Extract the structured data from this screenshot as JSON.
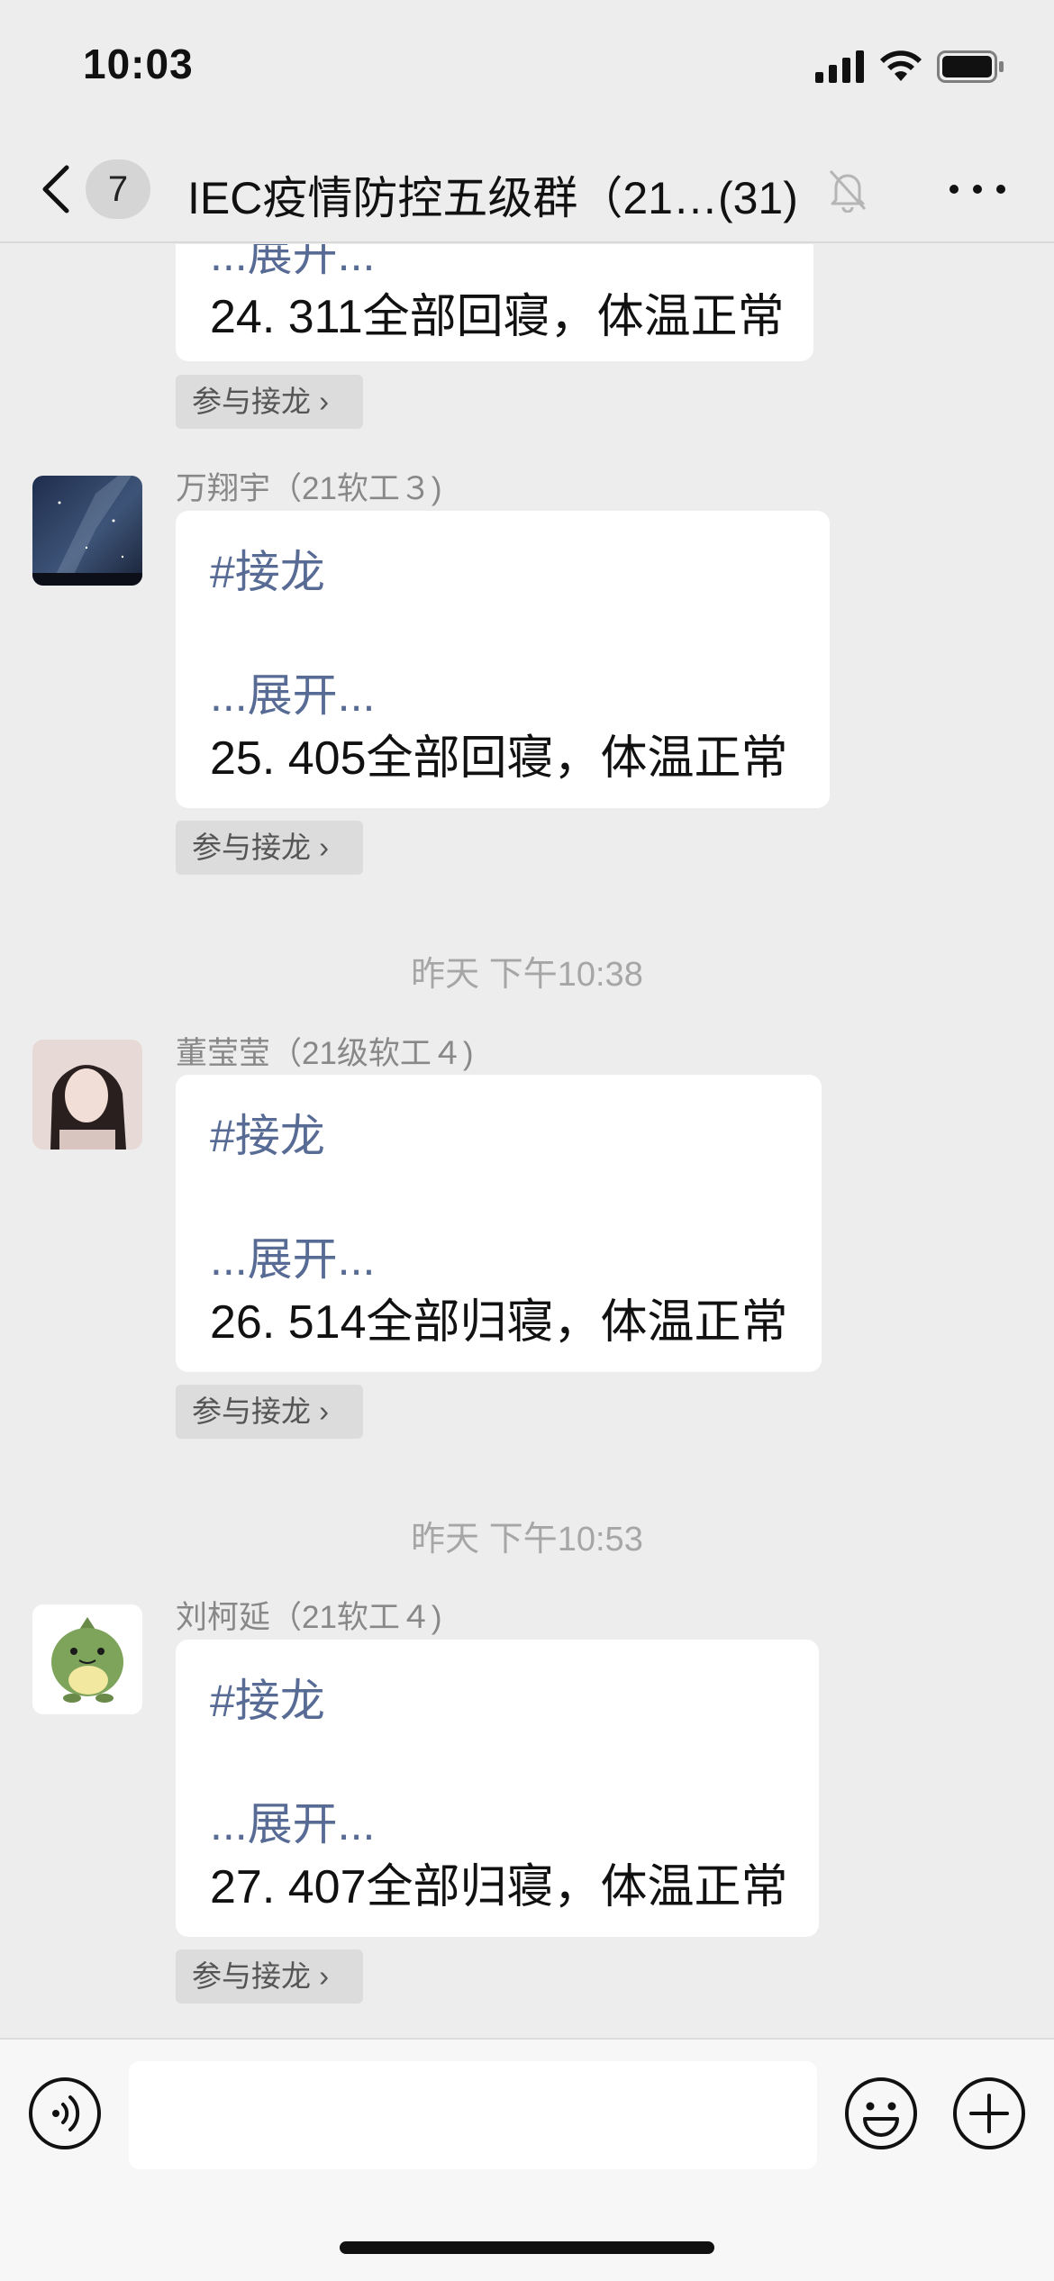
{
  "status_bar": {
    "time": "10:03"
  },
  "header": {
    "unread_count": "7",
    "title": "IEC疫情防控五级群（21…(31)"
  },
  "messages": [
    {
      "expand": "...展开...",
      "content": "24. 311全部回寝，体温正常",
      "join_label": "参与接龙 ›"
    },
    {
      "sender": "万翔宇（21软工３)",
      "hashtag": "#接龙",
      "expand": "...展开...",
      "content": "25. 405全部回寝，体温正常",
      "join_label": "参与接龙 ›"
    },
    {
      "timestamp": "昨天 下午10:38",
      "sender": "董莹莹（21级软工４)",
      "hashtag": "#接龙",
      "expand": "...展开...",
      "content": "26. 514全部归寝，体温正常",
      "join_label": "参与接龙 ›"
    },
    {
      "timestamp": "昨天 下午10:53",
      "sender": "刘柯延（21软工４)",
      "hashtag": "#接龙",
      "expand": "...展开...",
      "content": "27. 407全部归寝，体温正常",
      "join_label": "参与接龙 ›"
    }
  ],
  "input": {
    "value": ""
  },
  "colors": {
    "link": "#576b95",
    "background": "#ededed"
  }
}
